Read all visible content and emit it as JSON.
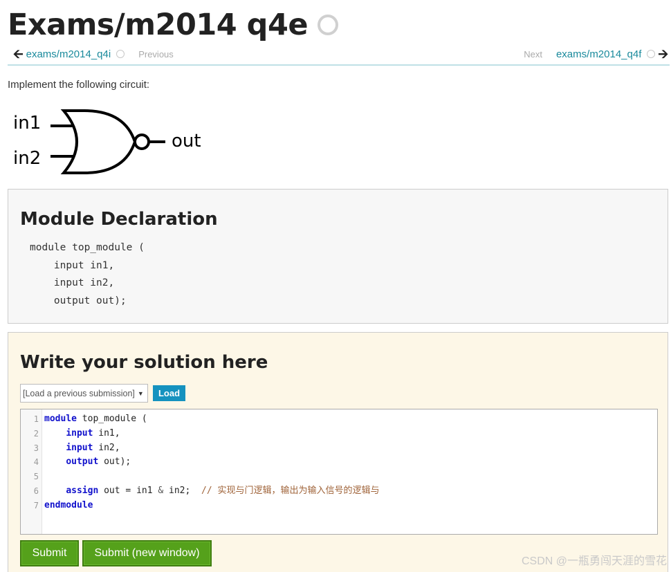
{
  "page": {
    "title": "Exams/m2014 q4e"
  },
  "nav": {
    "prev_link": "exams/m2014_q4i",
    "prev_label": "Previous",
    "next_label": "Next",
    "next_link": "exams/m2014_q4f"
  },
  "problem": {
    "intro": "Implement the following circuit:",
    "gate": {
      "type": "nor-gate",
      "input1": "in1",
      "input2": "in2",
      "output": "out"
    }
  },
  "declaration": {
    "heading": "Module Declaration",
    "lines": [
      "module top_module (",
      "    input in1,",
      "    input in2,",
      "    output out);"
    ]
  },
  "solution": {
    "heading": "Write your solution here",
    "select_value": "[Load a previous submission]",
    "load_label": "Load",
    "line_numbers": [
      "1",
      "2",
      "3",
      "4",
      "5",
      "6",
      "7"
    ],
    "code": [
      [
        {
          "t": "kw",
          "v": "module"
        },
        {
          "t": "",
          "v": " top_module ("
        }
      ],
      [
        {
          "t": "",
          "v": "    "
        },
        {
          "t": "kw",
          "v": "input"
        },
        {
          "t": "",
          "v": " in1,"
        }
      ],
      [
        {
          "t": "",
          "v": "    "
        },
        {
          "t": "kw",
          "v": "input"
        },
        {
          "t": "",
          "v": " in2,"
        }
      ],
      [
        {
          "t": "",
          "v": "    "
        },
        {
          "t": "kw",
          "v": "output"
        },
        {
          "t": "",
          "v": " out);"
        }
      ],
      [
        {
          "t": "",
          "v": ""
        }
      ],
      [
        {
          "t": "",
          "v": "    "
        },
        {
          "t": "kw",
          "v": "assign"
        },
        {
          "t": "",
          "v": " out = in1 "
        },
        {
          "t": "op",
          "v": "&"
        },
        {
          "t": "",
          "v": " in2;  "
        },
        {
          "t": "cm",
          "v": "// 实现与门逻辑，输出为输入信号的逻辑与"
        }
      ],
      [
        {
          "t": "kw",
          "v": "endmodule"
        }
      ]
    ],
    "submit_label": "Submit",
    "submit_new_window_label": "Submit (new window)"
  },
  "watermark": "CSDN @一瓶勇闯天涯的雪花",
  "colors": {
    "link": "#1a8a9c",
    "load_button": "#1592bf",
    "submit_button": "#55a11b",
    "keyword": "#1111cc",
    "comment": "#a0643a"
  }
}
